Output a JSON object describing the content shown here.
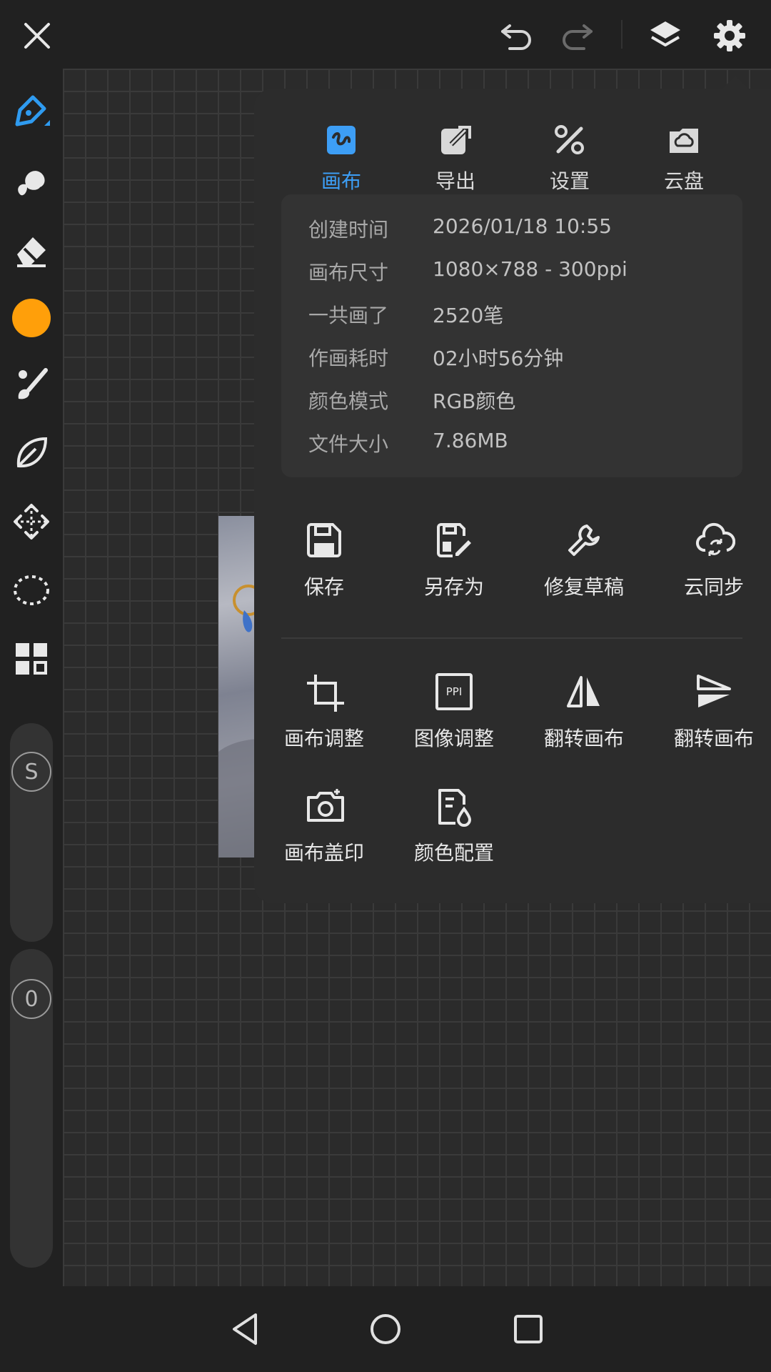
{
  "colors": {
    "accent": "#3d9ef5",
    "brush_color": "#ff9f0a",
    "panel_bg": "#2c2c2c"
  },
  "topbar": {
    "icons": [
      "close-icon",
      "undo-icon",
      "redo-icon",
      "layers-icon",
      "gear-icon"
    ]
  },
  "toolbar": {
    "icons": [
      "pen-icon",
      "smudge-icon",
      "eraser-icon",
      "color-swatch",
      "brush-icon",
      "leaf-icon",
      "move-icon",
      "lasso-icon",
      "grid-icon"
    ],
    "size_slider_label": "S",
    "opacity_slider_label": "0"
  },
  "panel": {
    "tabs": [
      {
        "label": "画布",
        "icon": "canvas-icon",
        "active": true
      },
      {
        "label": "导出",
        "icon": "export-icon",
        "active": false
      },
      {
        "label": "设置",
        "icon": "tools-icon",
        "active": false
      },
      {
        "label": "云盘",
        "icon": "cloud-drive-icon",
        "active": false
      }
    ],
    "info": [
      {
        "key": "创建时间",
        "value": "2026/01/18 10:55"
      },
      {
        "key": "画布尺寸",
        "value": "1080×788 - 300ppi"
      },
      {
        "key": "一共画了",
        "value": "2520笔"
      },
      {
        "key": "作画耗时",
        "value": "02小时56分钟"
      },
      {
        "key": "颜色模式",
        "value": "RGB颜色"
      },
      {
        "key": "文件大小",
        "value": "7.86MB"
      }
    ],
    "actions_row1": [
      {
        "label": "保存",
        "icon": "save-icon"
      },
      {
        "label": "另存为",
        "icon": "save-as-icon"
      },
      {
        "label": "修复草稿",
        "icon": "wrench-icon"
      },
      {
        "label": "云同步",
        "icon": "cloud-sync-icon"
      }
    ],
    "actions_row2": [
      {
        "label": "画布调整",
        "icon": "crop-icon"
      },
      {
        "label": "图像调整",
        "icon": "ppi-icon",
        "icon_text": "PPI"
      },
      {
        "label": "翻转画布",
        "icon": "flip-horizontal-icon"
      },
      {
        "label": "翻转画布",
        "icon": "flip-vertical-icon"
      }
    ],
    "actions_row3": [
      {
        "label": "画布盖印",
        "icon": "camera-icon"
      },
      {
        "label": "颜色配置",
        "icon": "color-profile-icon"
      }
    ]
  },
  "navbar": {
    "icons": [
      "back-icon",
      "home-icon",
      "recents-icon"
    ]
  }
}
